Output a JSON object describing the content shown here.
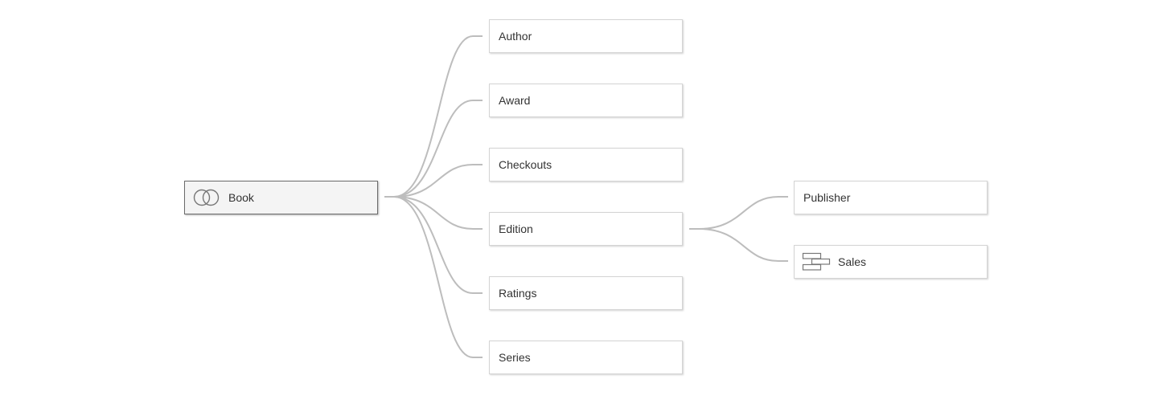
{
  "root": {
    "label": "Book",
    "icon": "union-circles-icon"
  },
  "children": [
    {
      "label": "Author"
    },
    {
      "label": "Award"
    },
    {
      "label": "Checkouts"
    },
    {
      "label": "Edition"
    },
    {
      "label": "Ratings"
    },
    {
      "label": "Series"
    }
  ],
  "edition_children": [
    {
      "label": "Publisher"
    },
    {
      "label": "Sales",
      "icon": "joined-tables-icon"
    }
  ],
  "colors": {
    "link": "#bdbdbd",
    "root_border": "#6b6b6b",
    "node_border": "#d4d4d4"
  }
}
